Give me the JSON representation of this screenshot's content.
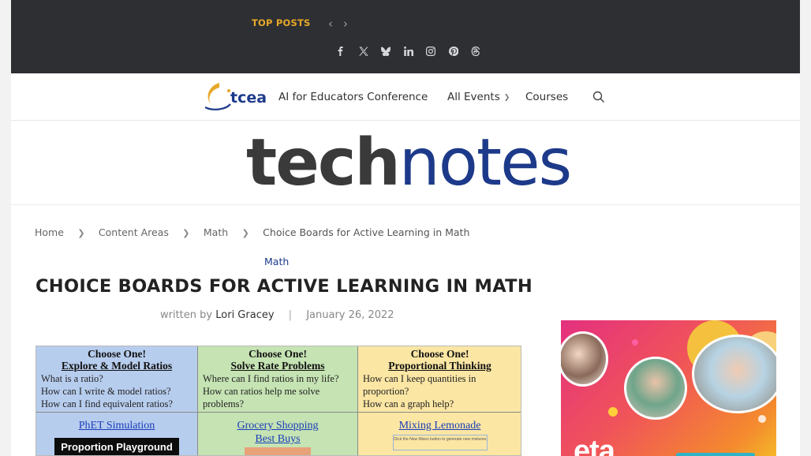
{
  "topbar": {
    "label": "TOP POSTS",
    "prev_icon": "chevron-left-icon",
    "next_icon": "chevron-right-icon",
    "social": [
      "facebook-icon",
      "x-icon",
      "bluesky-icon",
      "linkedin-icon",
      "instagram-icon",
      "pinterest-icon",
      "threads-icon"
    ]
  },
  "nav": {
    "logo_text": "tcea",
    "items": [
      {
        "label": "AI for Educators Conference"
      },
      {
        "label": "All Events"
      },
      {
        "label": "Courses"
      }
    ],
    "search_icon": "search-icon"
  },
  "masthead": {
    "part1": "tech",
    "part2": "notes"
  },
  "breadcrumb": [
    "Home",
    "Content Areas",
    "Math",
    "Choice Boards for Active Learning in Math"
  ],
  "article": {
    "category": "Math",
    "title": "CHOICE BOARDS FOR ACTIVE LEARNING IN MATH",
    "written_by": "written by",
    "author": "Lori Gracey",
    "date": "January 26, 2022"
  },
  "featured": {
    "cols": [
      {
        "head": "Choose One!",
        "sub": "Explore & Model Ratios",
        "q": [
          "What is a ratio?",
          "How can I write & model ratios?",
          "How can I find equivalent ratios?"
        ],
        "link": "PhET Simulation",
        "link2": "",
        "box": "Proportion Playground"
      },
      {
        "head": "Choose One!",
        "sub": "Solve Rate Problems",
        "q": [
          "Where can I find ratios in my life?",
          "How can ratios help me solve",
          "problems?"
        ],
        "link": "Grocery Shopping",
        "link2": "Best Buys",
        "box": ""
      },
      {
        "head": "Choose One!",
        "sub": "Proportional Thinking",
        "q": [
          "How can I keep quantities in",
          "proportion?",
          "How can a graph help?"
        ],
        "link": "Mixing Lemonade",
        "link2": "",
        "box": "Click the New Mixes button to generate new mixtures"
      }
    ]
  },
  "ad": {
    "text": "eta"
  },
  "colors": {
    "topbar": "#2d2f33",
    "accent": "#e8a829",
    "brand_blue": "#1d3a8a"
  }
}
